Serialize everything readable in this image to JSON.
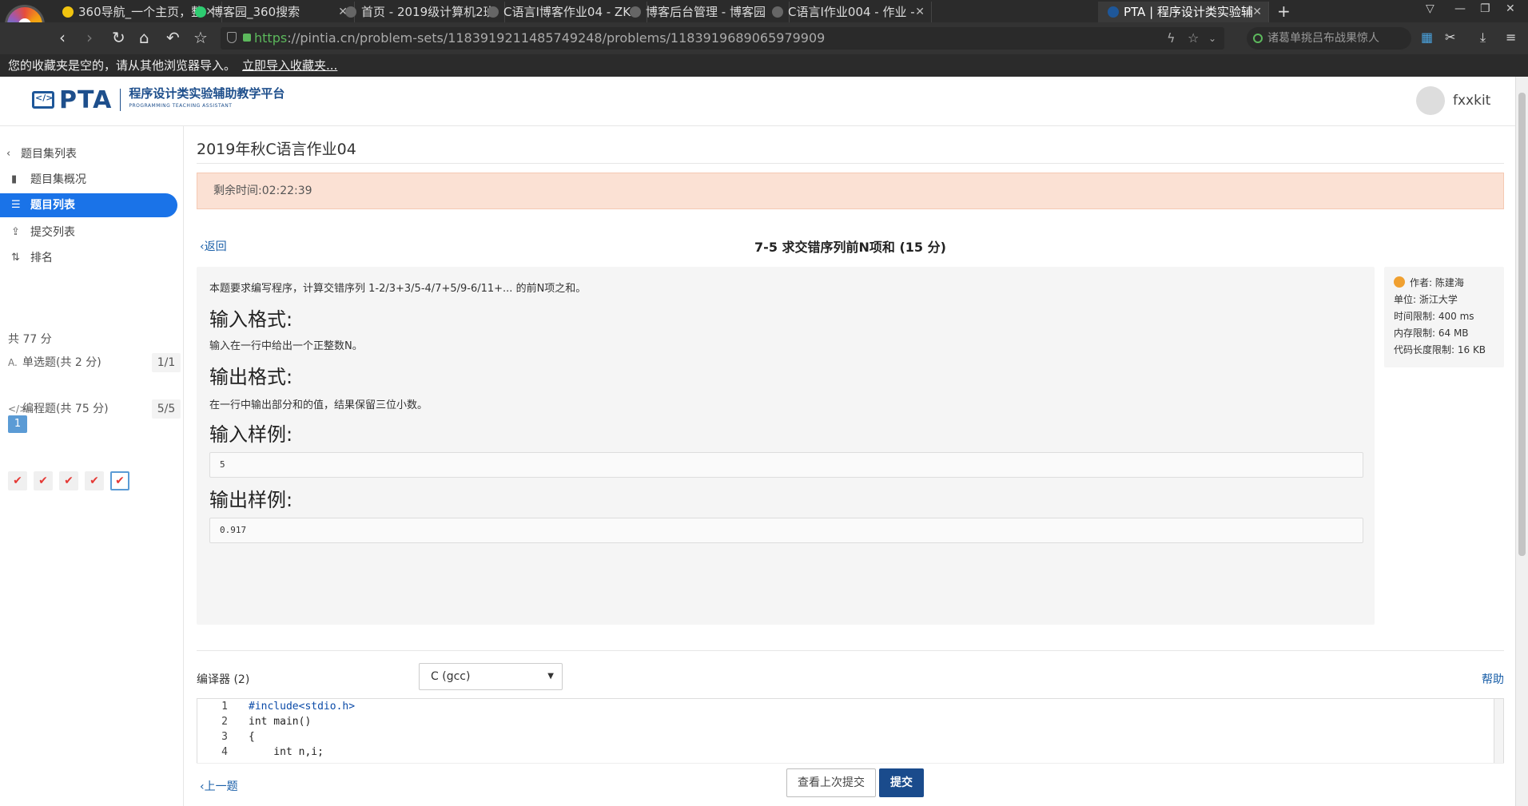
{
  "browser": {
    "tabs": [
      {
        "label": "360导航_一个主页，整",
        "icon_color": "#f1c40f"
      },
      {
        "label": "博客园_360搜索",
        "icon_color": "#2ecc71"
      },
      {
        "label": "首页 - 2019级计算机2班",
        "icon_color": "#666666"
      },
      {
        "label": "C语言I博客作业04 - ZK",
        "icon_color": "#666666"
      },
      {
        "label": "博客后台管理 - 博客园",
        "icon_color": "#666666"
      },
      {
        "label": "C语言I作业004 - 作业 -",
        "icon_color": "#666666"
      },
      {
        "label": "PTA | 程序设计类实验辅",
        "icon_color": "#1e5799"
      }
    ],
    "url_scheme": "https",
    "url_rest": "://pintia.cn/problem-sets/1183919211485749248/problems/1183919689065979909",
    "search_placeholder": "诸葛单挑吕布战果惊人",
    "bookmark_notice": "您的收藏夹是空的，请从其他浏览器导入。",
    "bookmark_link": "立即导入收藏夹..."
  },
  "header": {
    "logo_text": "PTA",
    "logo_subtitle": "程序设计类实验辅助教学平台",
    "logo_subtitle_en": "PROGRAMMING TEACHING ASSISTANT",
    "username": "fxxkit"
  },
  "sidebar": {
    "back_label": "题目集列表",
    "items": [
      {
        "label": "题目集概况",
        "icon": "book-icon"
      },
      {
        "label": "题目列表",
        "icon": "list-icon"
      },
      {
        "label": "提交列表",
        "icon": "upload-icon"
      },
      {
        "label": "排名",
        "icon": "sort-icon"
      }
    ],
    "total": "共 77 分",
    "groups": [
      {
        "label": "单选题(共 2 分)",
        "count": "1/1"
      },
      {
        "label": "编程题(共 75 分)",
        "count": "5/5"
      }
    ],
    "single_choice_numbers": [
      "1"
    ],
    "check_marks": [
      "✔",
      "✔",
      "✔",
      "✔",
      "✔"
    ]
  },
  "main": {
    "set_title": "2019年秋C语言作业04",
    "timer": "剩余时间:02:22:39",
    "back_link": "返回",
    "problem_title": "7-5 求交错序列前N项和 (15 分)",
    "description": "本题要求编写程序，计算交错序列 1-2/3+3/5-4/7+5/9-6/11+... 的前N项之和。",
    "input_format_h": "输入格式:",
    "input_format": "输入在一行中给出一个正整数N。",
    "output_format_h": "输出格式:",
    "output_format": "在一行中输出部分和的值，结果保留三位小数。",
    "input_sample_h": "输入样例:",
    "input_sample": "5",
    "output_sample_h": "输出样例:",
    "output_sample": "0.917",
    "info": {
      "author": "作者: 陈建海",
      "unit": "单位: 浙江大学",
      "time_limit": "时间限制: 400 ms",
      "memory_limit": "内存限制: 64 MB",
      "code_limit": "代码长度限制: 16 KB"
    },
    "compiler_label": "编译器 (2)",
    "compiler_value": "C (gcc)",
    "help_link": "帮助",
    "code_lines": [
      "#include<stdio.h>",
      "int main()",
      "{",
      "    int n,i;"
    ],
    "line_numbers": [
      "1",
      "2",
      "3",
      "4"
    ],
    "prev_link": "上一题",
    "last_submit_button": "查看上次提交",
    "submit_button": "提交"
  }
}
